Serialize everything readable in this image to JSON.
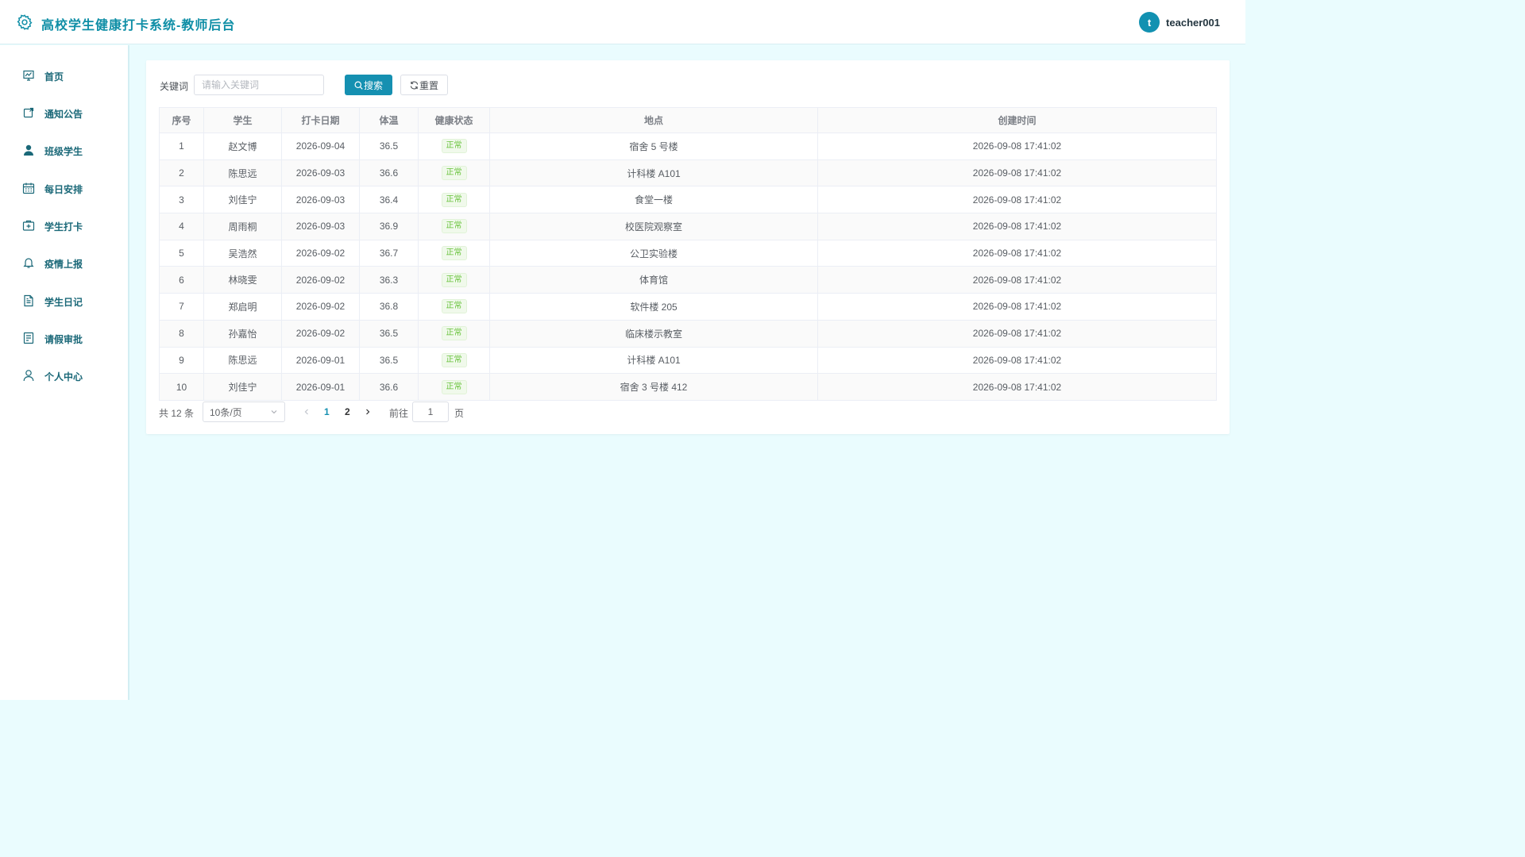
{
  "header": {
    "title": "高校学生健康打卡系统-教师后台",
    "avatar_letter": "t",
    "username": "teacher001"
  },
  "sidebar": {
    "items": [
      {
        "label": "首页",
        "icon": "dashboard-icon"
      },
      {
        "label": "通知公告",
        "icon": "notice-icon"
      },
      {
        "label": "班级学生",
        "icon": "user-filled-icon"
      },
      {
        "label": "每日安排",
        "icon": "calendar-icon"
      },
      {
        "label": "学生打卡",
        "icon": "first-aid-kit-icon"
      },
      {
        "label": "疫情上报",
        "icon": "bell-icon"
      },
      {
        "label": "学生日记",
        "icon": "document-icon"
      },
      {
        "label": "请假审批",
        "icon": "tickets-icon"
      },
      {
        "label": "个人中心",
        "icon": "user-icon"
      }
    ]
  },
  "search": {
    "label": "关键词",
    "placeholder": "请输入关键词",
    "value": "",
    "search_button": "搜索",
    "reset_button": "重置"
  },
  "table": {
    "columns": [
      "序号",
      "学生",
      "打卡日期",
      "体温",
      "健康状态",
      "地点",
      "创建时间"
    ],
    "rows": [
      [
        "1",
        "赵文博",
        "2026-09-04",
        "36.5",
        "正常",
        "宿舍 5 号楼",
        "2026-09-08 17:41:02"
      ],
      [
        "2",
        "陈思远",
        "2026-09-03",
        "36.6",
        "正常",
        "计科楼 A101",
        "2026-09-08 17:41:02"
      ],
      [
        "3",
        "刘佳宁",
        "2026-09-03",
        "36.4",
        "正常",
        "食堂一楼",
        "2026-09-08 17:41:02"
      ],
      [
        "4",
        "周雨桐",
        "2026-09-03",
        "36.9",
        "正常",
        "校医院观察室",
        "2026-09-08 17:41:02"
      ],
      [
        "5",
        "吴浩然",
        "2026-09-02",
        "36.7",
        "正常",
        "公卫实验楼",
        "2026-09-08 17:41:02"
      ],
      [
        "6",
        "林晓雯",
        "2026-09-02",
        "36.3",
        "正常",
        "体育馆",
        "2026-09-08 17:41:02"
      ],
      [
        "7",
        "郑启明",
        "2026-09-02",
        "36.8",
        "正常",
        "软件楼 205",
        "2026-09-08 17:41:02"
      ],
      [
        "8",
        "孙嘉怡",
        "2026-09-02",
        "36.5",
        "正常",
        "临床楼示教室",
        "2026-09-08 17:41:02"
      ],
      [
        "9",
        "陈思远",
        "2026-09-01",
        "36.5",
        "正常",
        "计科楼 A101",
        "2026-09-08 17:41:02"
      ],
      [
        "10",
        "刘佳宁",
        "2026-09-01",
        "36.6",
        "正常",
        "宿舍 3 号楼 412",
        "2026-09-08 17:41:02"
      ]
    ]
  },
  "pagination": {
    "total_text": "共 12 条",
    "page_size": "10条/页",
    "pages": [
      "1",
      "2"
    ],
    "current_page": "1",
    "goto_label": "前往",
    "goto_value": "1",
    "goto_suffix": "页"
  },
  "colors": {
    "accent": "#1590b1",
    "title": "#0e8ea6",
    "background": "#eafcfe",
    "tag_green": "#67c23a"
  }
}
